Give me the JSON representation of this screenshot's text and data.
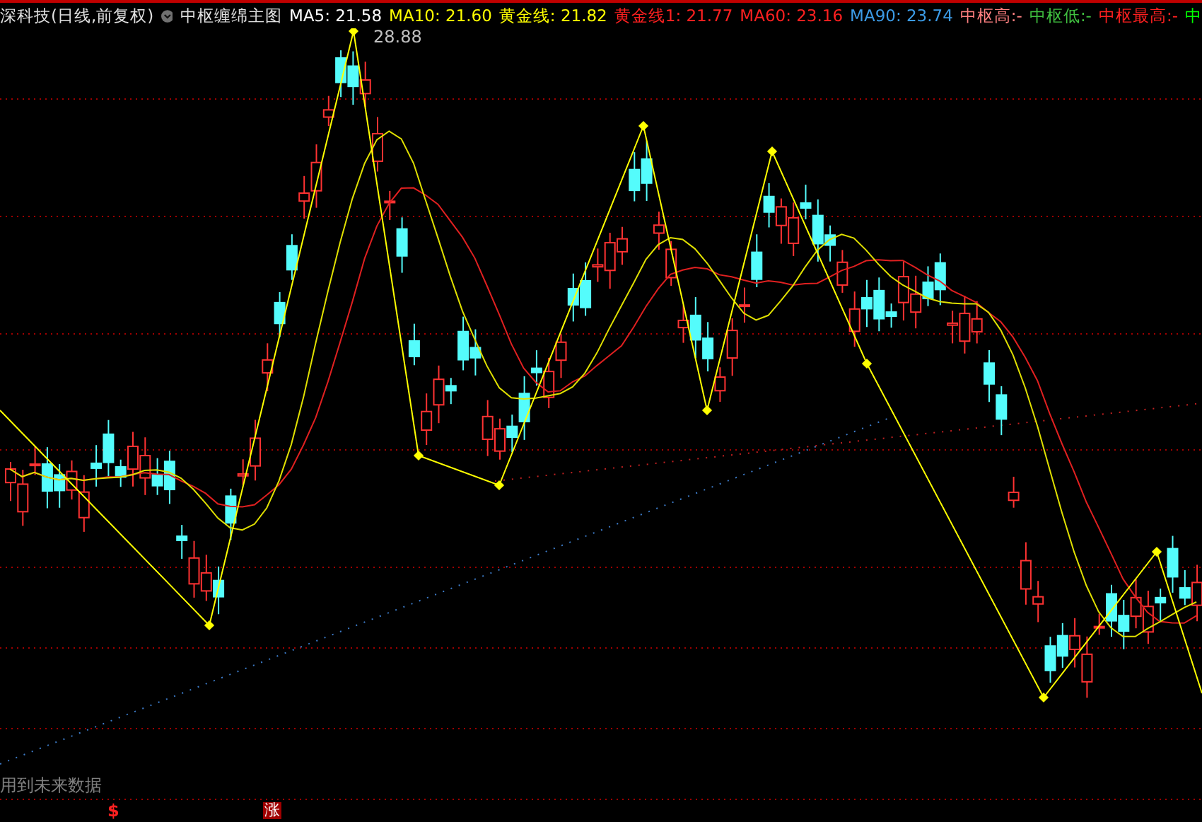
{
  "header": {
    "title": "深科技(日线,前复权)",
    "indicator": "中枢缠绵主图",
    "legend": [
      {
        "text": "MA5: 21.58",
        "color": "#ffffff"
      },
      {
        "text": "MA10: 21.60",
        "color": "#ffff00"
      },
      {
        "text": "黄金线: 21.82",
        "color": "#ffff00"
      },
      {
        "text": "黄金线1: 21.77",
        "color": "#ff2020"
      },
      {
        "text": "MA60: 23.16",
        "color": "#ff2020"
      },
      {
        "text": "MA90: 23.74",
        "color": "#3c9be6"
      },
      {
        "text": "中枢高:-",
        "color": "#ff8080"
      },
      {
        "text": "中枢低:-",
        "color": "#40c040"
      },
      {
        "text": "中枢最高:-",
        "color": "#ff2020"
      },
      {
        "text": "中",
        "color": "#00ff00"
      }
    ]
  },
  "chart": {
    "peak_label": "28.88",
    "note": "用到未来数据"
  },
  "markers": [
    {
      "kind": "dollar",
      "text": "$"
    },
    {
      "kind": "rise",
      "text": "涨"
    }
  ]
}
